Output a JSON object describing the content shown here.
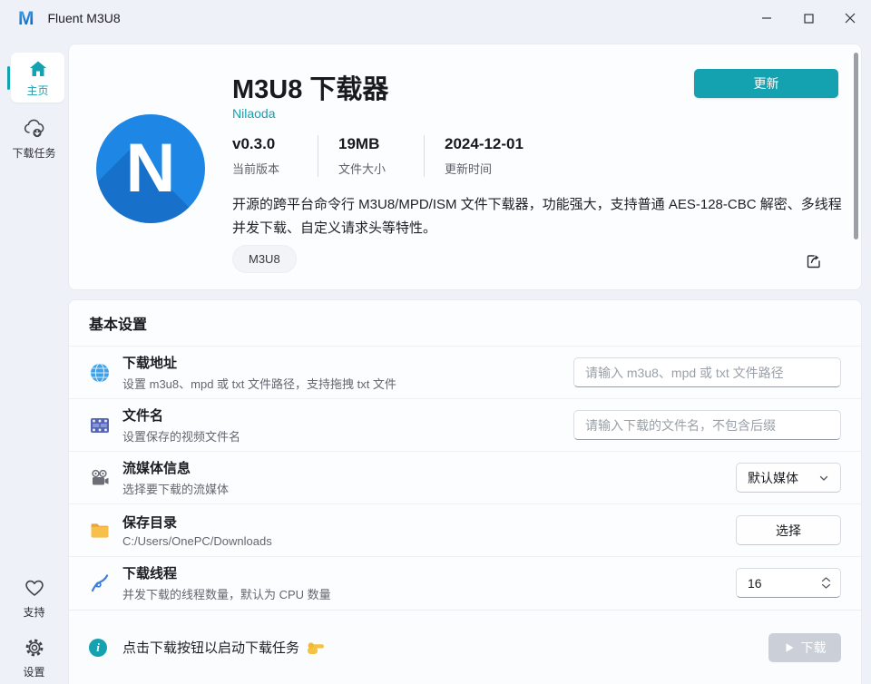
{
  "colors": {
    "accent": "#14a1b0",
    "logo_blue": "#1e87e6",
    "disabled_btn": "#cbd0d8"
  },
  "window": {
    "title": "Fluent M3U8"
  },
  "sidebar": {
    "home": "主页",
    "tasks": "下载任务",
    "support": "支持",
    "settings": "设置"
  },
  "hero": {
    "title": "M3U8 下载器",
    "author": "Nilaoda",
    "update_button": "更新",
    "logo_letter": "N",
    "stats": [
      {
        "value": "v0.3.0",
        "label": "当前版本"
      },
      {
        "value": "19MB",
        "label": "文件大小"
      },
      {
        "value": "2024-12-01",
        "label": "更新时间"
      }
    ],
    "description": "开源的跨平台命令行 M3U8/MPD/ISM 文件下载器，功能强大，支持普通 AES-128-CBC 解密、多线程并发下载、自定义请求头等特性。",
    "tag": "M3U8"
  },
  "settings": {
    "section_title": "基本设置",
    "rows": [
      {
        "icon": "globe-icon",
        "title": "下载地址",
        "subtitle": "设置 m3u8、mpd 或 txt 文件路径，支持拖拽 txt 文件",
        "placeholder": "请输入 m3u8、mpd 或 txt 文件路径"
      },
      {
        "icon": "film-icon",
        "title": "文件名",
        "subtitle": "设置保存的视频文件名",
        "placeholder": "请输入下载的文件名，不包含后缀"
      },
      {
        "icon": "movie-camera-icon",
        "title": "流媒体信息",
        "subtitle": "选择要下载的流媒体",
        "value": "默认媒体"
      },
      {
        "icon": "folder-icon",
        "title": "保存目录",
        "subtitle": "C:/Users/OnePC/Downloads",
        "value": "选择"
      },
      {
        "icon": "thread-icon",
        "title": "下载线程",
        "subtitle": "并发下载的线程数量，默认为 CPU 数量",
        "value": "16"
      }
    ]
  },
  "footer": {
    "hint": "点击下载按钮以启动下载任务",
    "download_button": "下载"
  }
}
